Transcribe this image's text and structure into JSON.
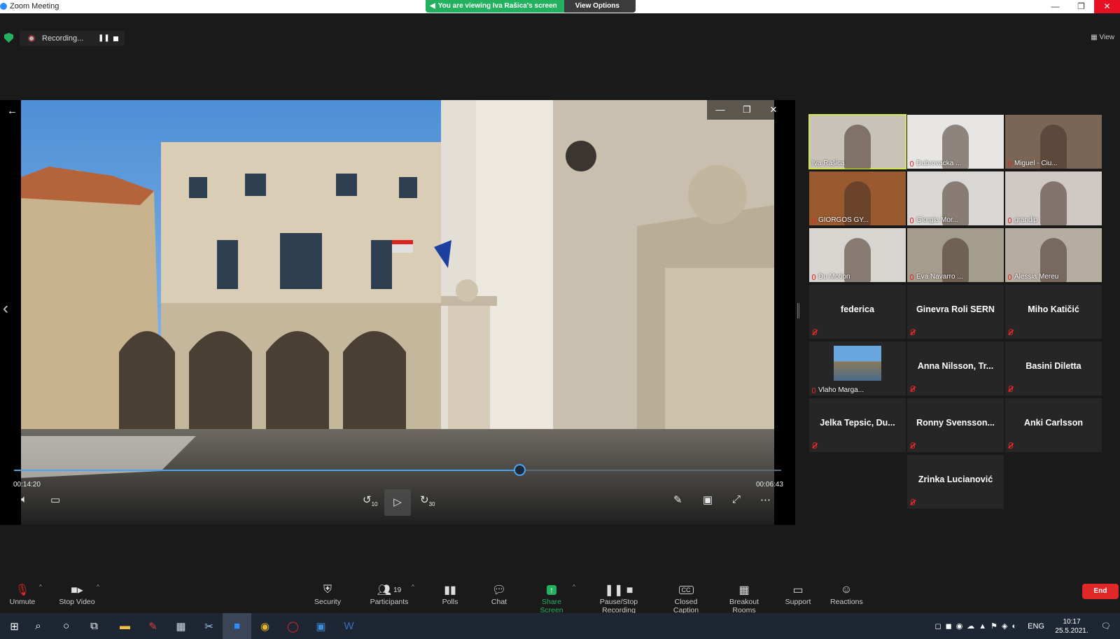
{
  "window": {
    "title": "Zoom Meeting",
    "viewing_banner": "You are viewing Iva Rašica's screen",
    "view_options": "View Options",
    "view_button": "View"
  },
  "recording": {
    "label": "Recording..."
  },
  "player": {
    "time_elapsed": "00:14:20",
    "time_remaining": "00:06:43",
    "progress_fraction": 0.66,
    "skip_back": "10",
    "skip_forward": "30"
  },
  "participants": [
    {
      "name": "Iva Rašica",
      "video": true,
      "active": true,
      "muted": false,
      "bg": "#c9c2b8"
    },
    {
      "name": "Dubrovacka ...",
      "video": true,
      "muted": true,
      "bg": "#e8e6e4"
    },
    {
      "name": "Miguel - Ciu...",
      "video": true,
      "muted": true,
      "bg": "#7b6656"
    },
    {
      "name": "GIORGOS GY...",
      "video": true,
      "muted": true,
      "bg": "#9a5a30"
    },
    {
      "name": "Giorgia Mor...",
      "video": true,
      "muted": true,
      "bg": "#d9d7d3"
    },
    {
      "name": "grandip",
      "video": true,
      "muted": true,
      "bg": "#cfc8c4"
    },
    {
      "name": "Du Motion",
      "video": true,
      "muted": true,
      "bg": "#d8d4cf"
    },
    {
      "name": "Eva Navarro ...",
      "video": true,
      "muted": true,
      "bg": "#a49c8c"
    },
    {
      "name": "Alessia Mereu",
      "video": true,
      "muted": true,
      "bg": "#b6ada1"
    },
    {
      "name": "federica",
      "video": false,
      "muted": true
    },
    {
      "name": "Ginevra Roli SERN",
      "video": false,
      "muted": true
    },
    {
      "name": "Miho Katičić",
      "video": false,
      "muted": true
    },
    {
      "name": "Vlaho Marga...",
      "video": "avatar",
      "muted": true
    },
    {
      "name": "Anna Nilsson, Tr...",
      "video": false,
      "muted": true
    },
    {
      "name": "Basini Diletta",
      "video": false,
      "muted": true
    },
    {
      "name": "Jelka Tepsic, Du...",
      "video": false,
      "muted": true
    },
    {
      "name": "Ronny Svensson...",
      "video": false,
      "muted": true
    },
    {
      "name": "Anki Carlsson",
      "video": false,
      "muted": true
    },
    {
      "name": "Zrinka Lucianović",
      "video": false,
      "muted": true
    }
  ],
  "toolbar": {
    "unmute": "Unmute",
    "stop_video": "Stop Video",
    "security": "Security",
    "participants": "Participants",
    "participants_count": "19",
    "polls": "Polls",
    "chat": "Chat",
    "share_screen": "Share Screen",
    "pause_stop_recording": "Pause/Stop Recording",
    "closed_caption": "Closed Caption",
    "breakout_rooms": "Breakout Rooms",
    "support": "Support",
    "reactions": "Reactions",
    "end": "End"
  },
  "taskbar": {
    "language": "ENG",
    "time": "10:17",
    "date": "25.5.2021."
  },
  "colors": {
    "zoom_green": "#23b15f",
    "end_red": "#e02828",
    "progress_blue": "#4ea3ef",
    "active_speaker": "#d1e84a"
  }
}
